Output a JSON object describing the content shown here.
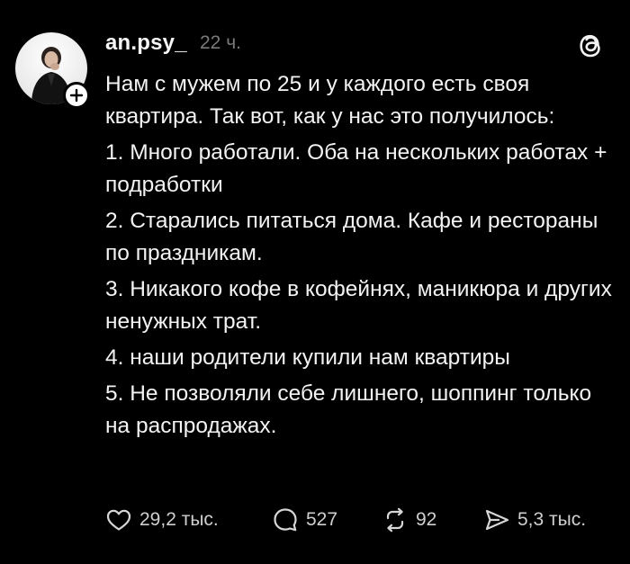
{
  "post": {
    "username": "an.psy_",
    "time": "22 ч.",
    "paragraphs": [
      "Нам с мужем по 25 и у каждого есть своя квартира. Так вот, как у нас это получилось:",
      "1. Много работали. Оба на нескольких работах + подработки",
      "2. Старались питаться дома. Кафе и рестораны по праздникам.",
      "3. Никакого кофе в кофейнях, маникюра и других ненужных трат.",
      "4. наши родители купили нам квартиры",
      "5. Не позволяли себе лишнего, шоппинг только на распродажах."
    ],
    "actions": {
      "likes": "29,2 тыс.",
      "comments": "527",
      "reposts": "92",
      "shares": "5,3 тыс."
    }
  },
  "icons": {
    "avatar": "profile-photo",
    "follow": "plus-icon",
    "brand": "threads-logo-icon",
    "like": "heart-icon",
    "comment": "comment-bubble-icon",
    "repost": "repost-icon",
    "share": "send-icon"
  },
  "colors": {
    "background": "#000000",
    "text": "#f3f3f3",
    "muted": "#7a7a7a"
  }
}
